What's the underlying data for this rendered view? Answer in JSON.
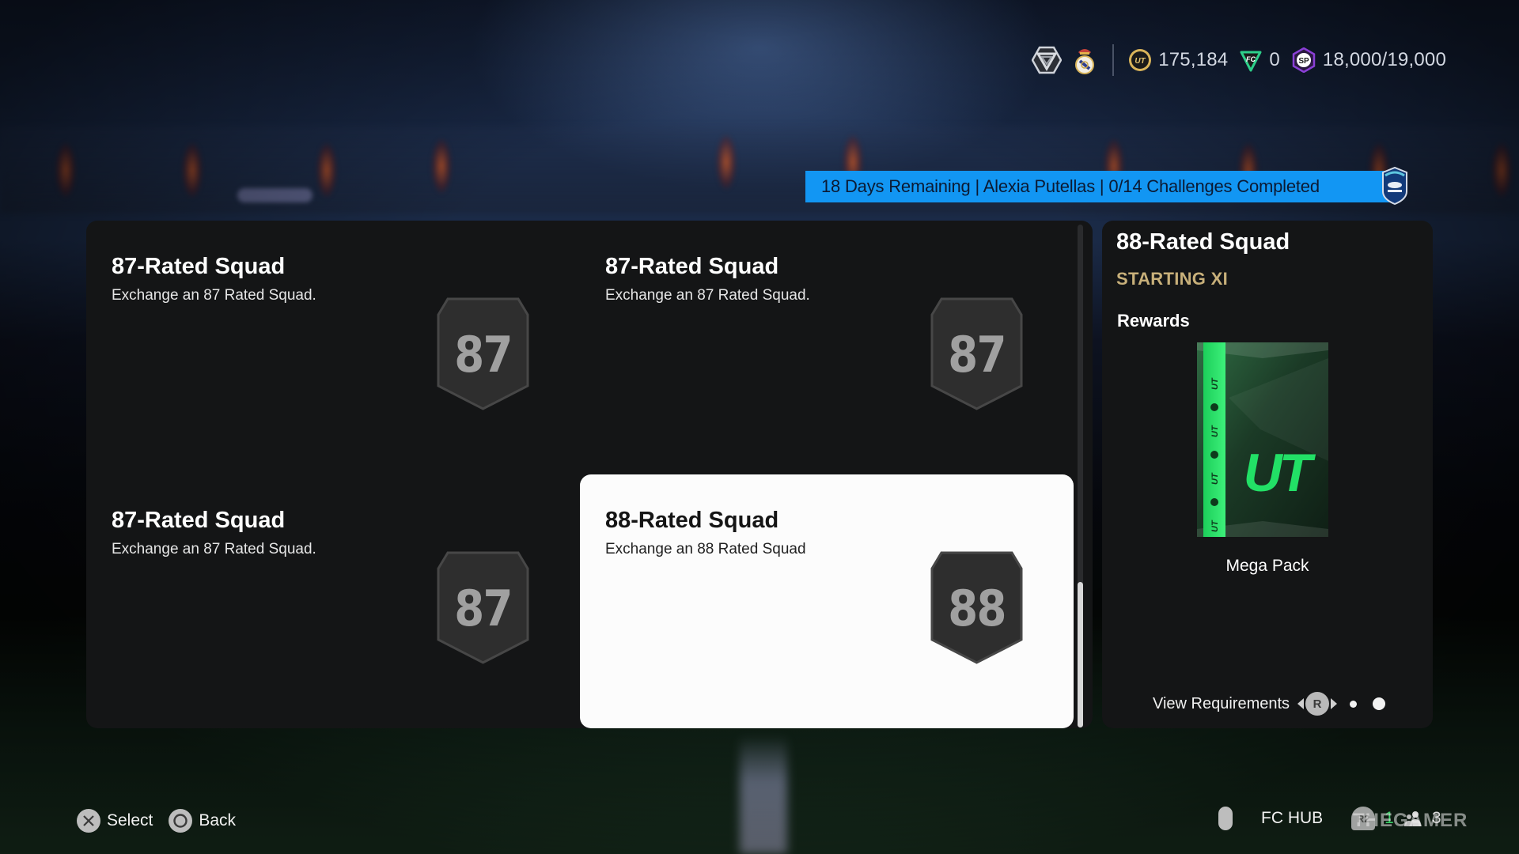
{
  "topbar": {
    "icons": [
      "season-rank-icon",
      "club-crest-icon"
    ],
    "coins": {
      "icon": "ut-coin-icon",
      "value": "175,184"
    },
    "fc_points": {
      "icon": "fc-points-icon",
      "value": "0"
    },
    "sp": {
      "icon": "sp-icon",
      "value": "18,000/19,000"
    }
  },
  "banner": {
    "text": "18 Days Remaining | Alexia Putellas | 0/14 Challenges Completed",
    "badge_icon": "liga-f-icon",
    "color": "#1296f3"
  },
  "challenges": [
    {
      "title": "87-Rated Squad",
      "description": "Exchange an 87 Rated Squad.",
      "rating": "87",
      "selected": false
    },
    {
      "title": "87-Rated Squad",
      "description": "Exchange an 87 Rated Squad.",
      "rating": "87",
      "selected": false
    },
    {
      "title": "87-Rated Squad",
      "description": "Exchange an 87 Rated Squad.",
      "rating": "87",
      "selected": false
    },
    {
      "title": "88-Rated Squad",
      "description": "Exchange an 88 Rated Squad",
      "rating": "88",
      "selected": true
    }
  ],
  "detail": {
    "title": "88-Rated Squad",
    "subtitle": "STARTING XI",
    "rewards_label": "Rewards",
    "reward_name": "Mega Pack",
    "reward_pack_logo": "UT",
    "view_requirements_label": "View Requirements",
    "r_button": "R",
    "page_index": 2,
    "page_count": 2,
    "accent_color": "#c8b07a"
  },
  "hints": {
    "select_label": "Select",
    "back_label": "Back",
    "fc_hub_label": "FC HUB",
    "r2_label": "R2",
    "notifications_count": "1",
    "friends_count": "3"
  },
  "watermark": "THEGAMER"
}
